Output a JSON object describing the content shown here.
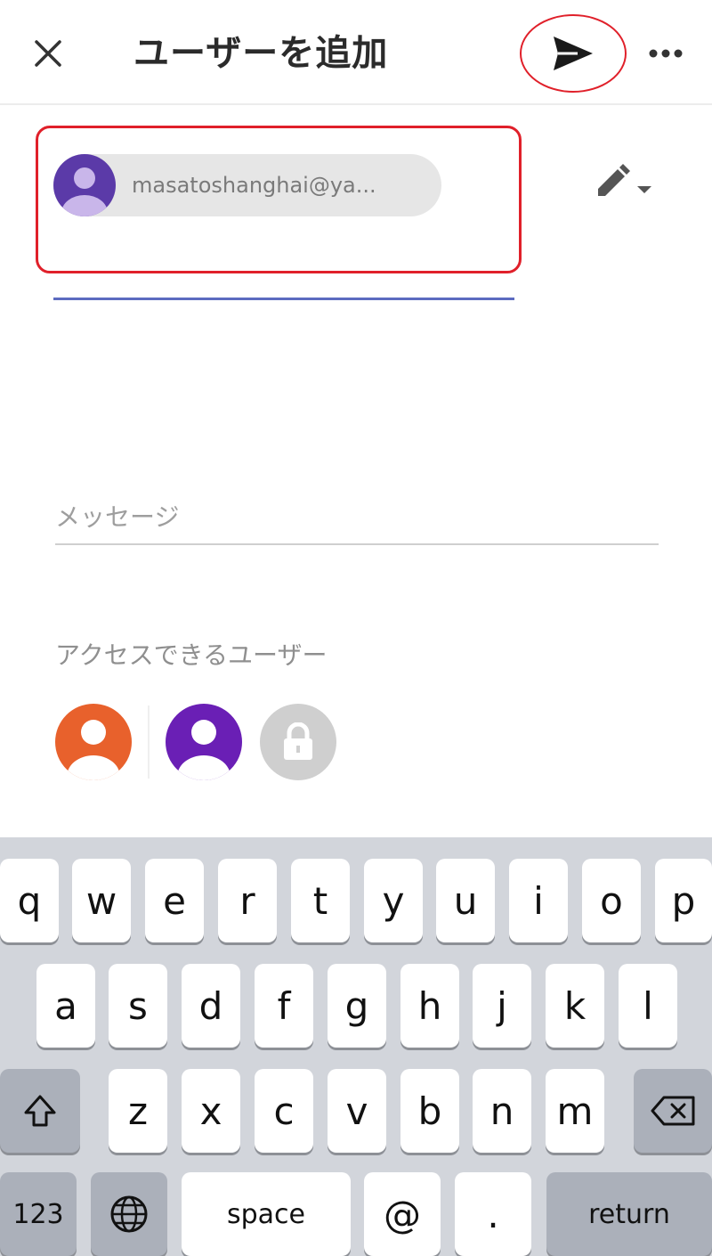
{
  "header": {
    "title": "ユーザーを追加"
  },
  "recipient": {
    "chip_email": "masatoshanghai@ya..."
  },
  "message": {
    "placeholder": "メッセージ"
  },
  "access": {
    "label": "アクセスできるユーザー"
  },
  "keyboard": {
    "row1": [
      "q",
      "w",
      "e",
      "r",
      "t",
      "y",
      "u",
      "i",
      "o",
      "p"
    ],
    "row2": [
      "a",
      "s",
      "d",
      "f",
      "g",
      "h",
      "j",
      "k",
      "l"
    ],
    "row3": [
      "z",
      "x",
      "c",
      "v",
      "b",
      "n",
      "m"
    ],
    "numbers_key": "123",
    "space_key": "space",
    "at_key": "@",
    "period_key": ".",
    "return_key": "return"
  },
  "colors": {
    "annotation_red": "#e0202a",
    "underline_blue": "#5c6bc0",
    "avatar_orange": "#e8612c",
    "avatar_purple": "#6a1fb5",
    "chip_avatar_purple": "#5b3aa8"
  },
  "icons": {
    "close": "close-icon",
    "send": "send-icon",
    "more": "more-icon",
    "edit": "pencil-icon",
    "dropdown": "caret-down-icon",
    "shift": "shift-icon",
    "backspace": "backspace-icon",
    "globe": "globe-icon",
    "lock": "lock-icon"
  }
}
